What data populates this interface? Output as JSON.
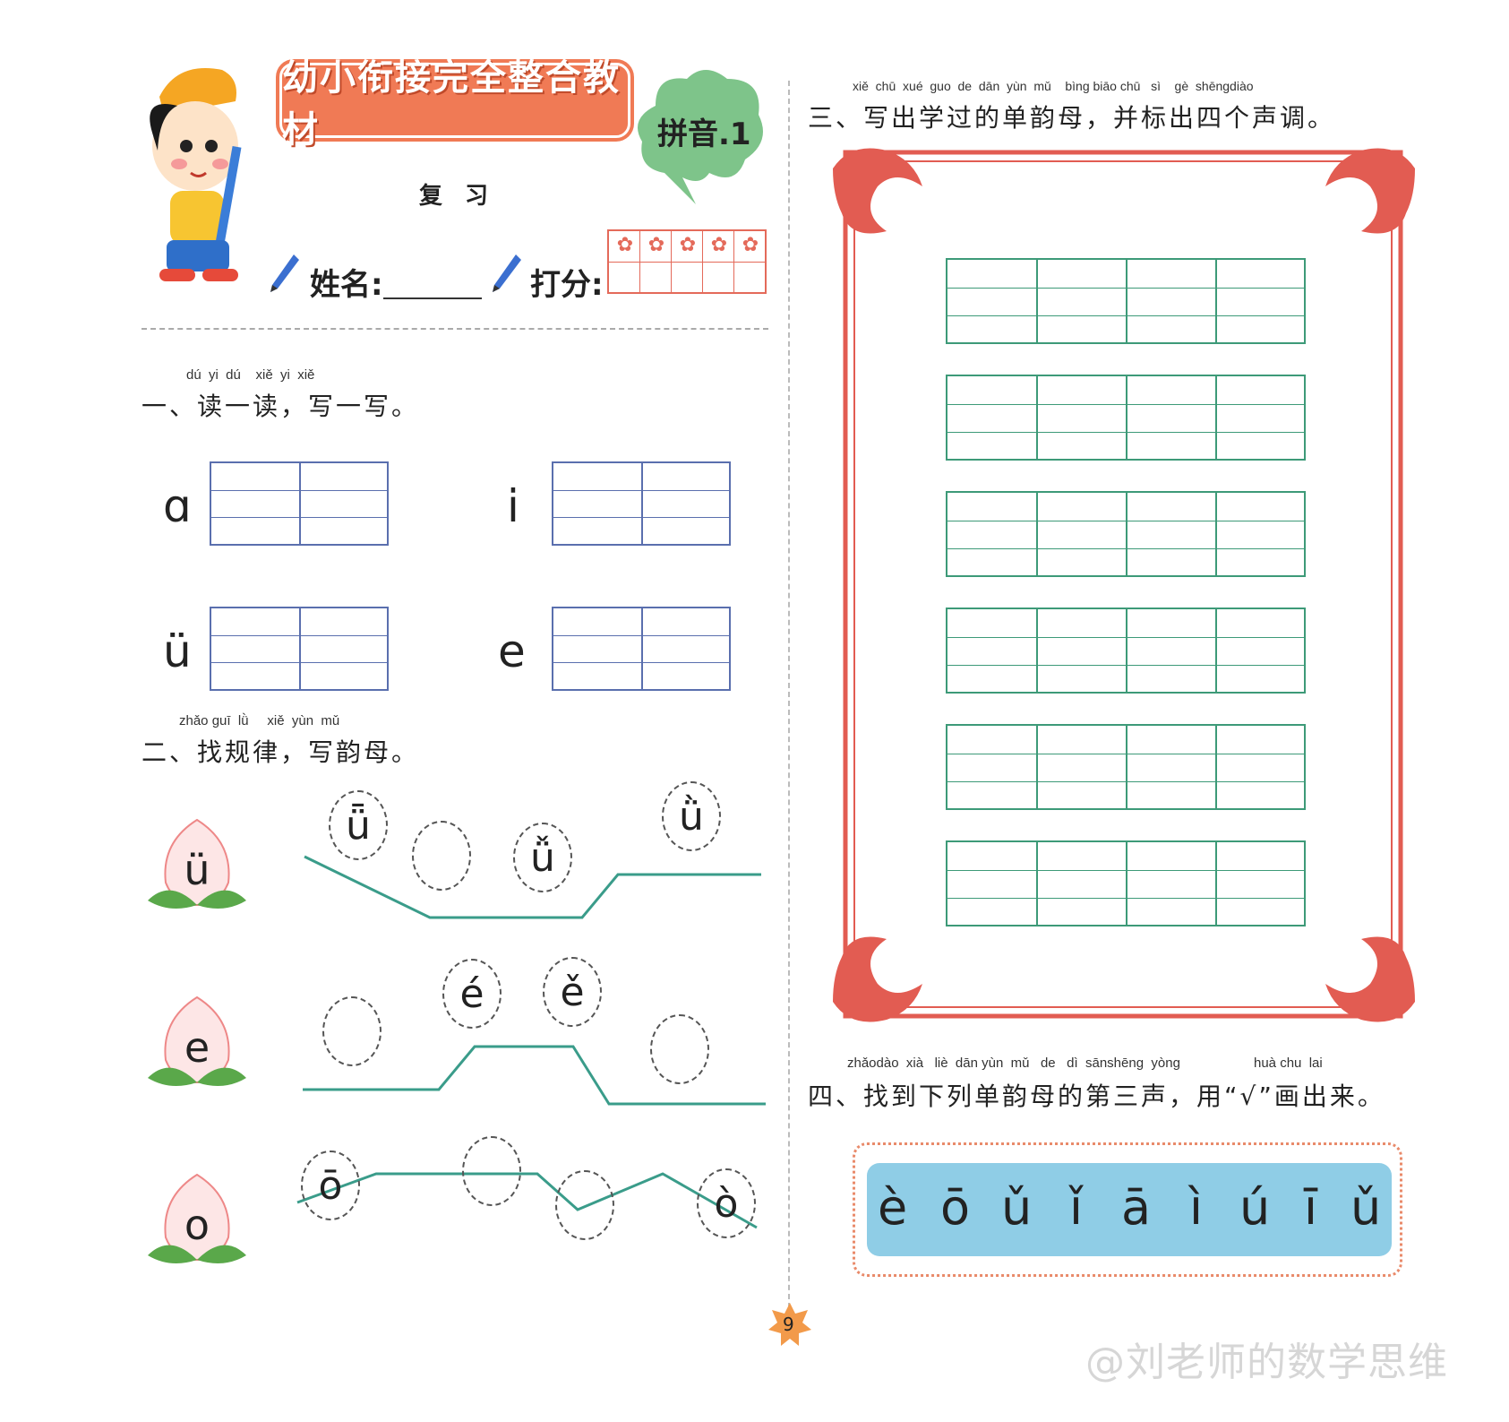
{
  "header": {
    "banner_title": "幼小衔接完全整合教材",
    "cloud_label": "拼音.1",
    "subtitle": "复 习",
    "name_label": "姓名:",
    "score_label": "打分:"
  },
  "section1": {
    "pinyin": "dú  yi  dú    xiě  yi  xiě",
    "title": "一、读一读，写一写。",
    "letters": [
      "ɑ",
      "i",
      "ü",
      "e"
    ]
  },
  "section2": {
    "pinyin": "zhǎo guī  lǜ     xiě  yùn  mǔ",
    "title": "二、找规律，写韵母。",
    "rows": [
      {
        "peach": "ü",
        "circles": [
          "ǖ",
          "",
          "ǚ",
          "ǜ"
        ]
      },
      {
        "peach": "e",
        "circles": [
          "",
          "é",
          "ě",
          ""
        ]
      },
      {
        "peach": "o",
        "circles": [
          "ō",
          "",
          "",
          "ò"
        ]
      }
    ]
  },
  "section3": {
    "pinyin": "xiě  chū  xué  guo  de  dān  yùn  mǔ    bìng biāo chū   sì    gè  shēngdiào",
    "title": "三、写出学过的单韵母，并标出四个声调。"
  },
  "section4": {
    "pinyin_left": "zhǎodào  xià   liè  dān yùn  mǔ   de   dì  sānshēng  yòng",
    "pinyin_right": "huà chu  lai",
    "title": "四、找到下列单韵母的第三声，用“√”画出来。",
    "vowels": [
      "è",
      "ō",
      "ǔ",
      "ǐ",
      "ā",
      "ì",
      "ú",
      "ī",
      "ǔ"
    ]
  },
  "footer": {
    "page_number": "9",
    "watermark": "@刘老师的数学思维"
  }
}
